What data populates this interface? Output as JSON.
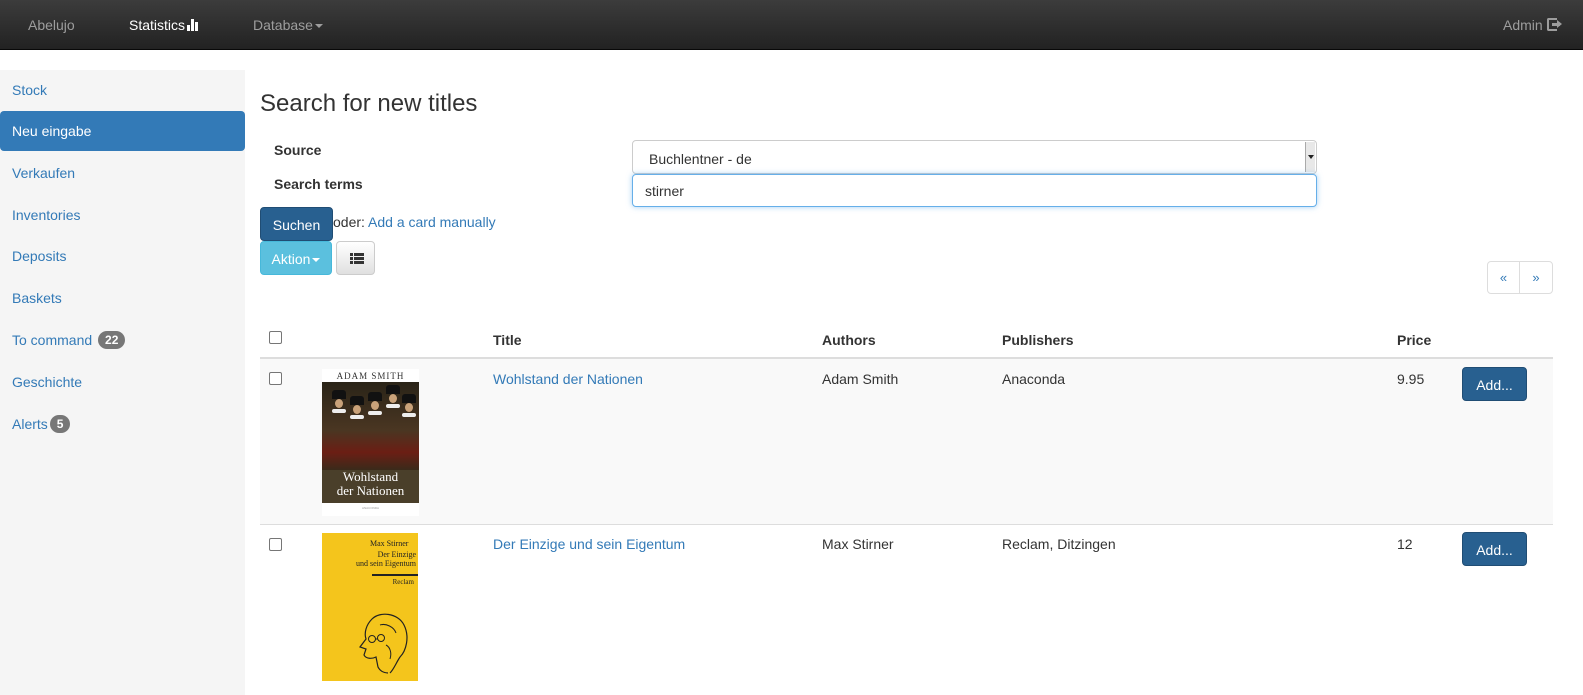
{
  "navbar": {
    "brand": "Abelujo",
    "statistics": "Statistics",
    "database": "Database",
    "user": "Admin"
  },
  "sidebar": {
    "items": [
      {
        "label": "Stock"
      },
      {
        "label": "Neu eingabe"
      },
      {
        "label": "Verkaufen"
      },
      {
        "label": "Inventories"
      },
      {
        "label": "Deposits"
      },
      {
        "label": "Baskets"
      },
      {
        "label": "To command",
        "badge": "22"
      },
      {
        "label": "Geschichte"
      },
      {
        "label": "Alerts",
        "badge": "5"
      }
    ]
  },
  "main": {
    "title": "Search for new titles",
    "source_label": "Source",
    "source_value": "Buchlentner - de",
    "search_terms_label": "Search terms",
    "search_value": "stirner",
    "search_button": "Suchen",
    "or_text": "oder:",
    "add_manual_link": "Add a card manually",
    "action_button": "Aktion",
    "pager_prev": "«",
    "pager_next": "»"
  },
  "table": {
    "headers": {
      "title": "Title",
      "authors": "Authors",
      "publishers": "Publishers",
      "price": "Price"
    },
    "rows": [
      {
        "title": "Wohlstand der Nationen",
        "author": "Adam Smith",
        "publisher": "Anaconda",
        "price": "9.95",
        "add": "Add..."
      },
      {
        "title": "Der Einzige und sein Eigentum",
        "author": "Max Stirner",
        "publisher": "Reclam, Ditzingen",
        "price": "12",
        "add": "Add..."
      }
    ]
  },
  "covers": {
    "cover1": {
      "author": "ADAM SMITH",
      "title_line1": "Wohlstand",
      "title_line2": "der Nationen",
      "publisher": "ANACONDA"
    },
    "cover2": {
      "author": "Max Stirner",
      "title_line1": "Der Einzige",
      "title_line2": "und sein Eigentum",
      "publisher": "Reclam"
    }
  },
  "colors": {
    "primary": "#337ab7",
    "primary_dark": "#286090",
    "info": "#5bc0de",
    "navbar": "#222222",
    "badge": "#777777"
  }
}
